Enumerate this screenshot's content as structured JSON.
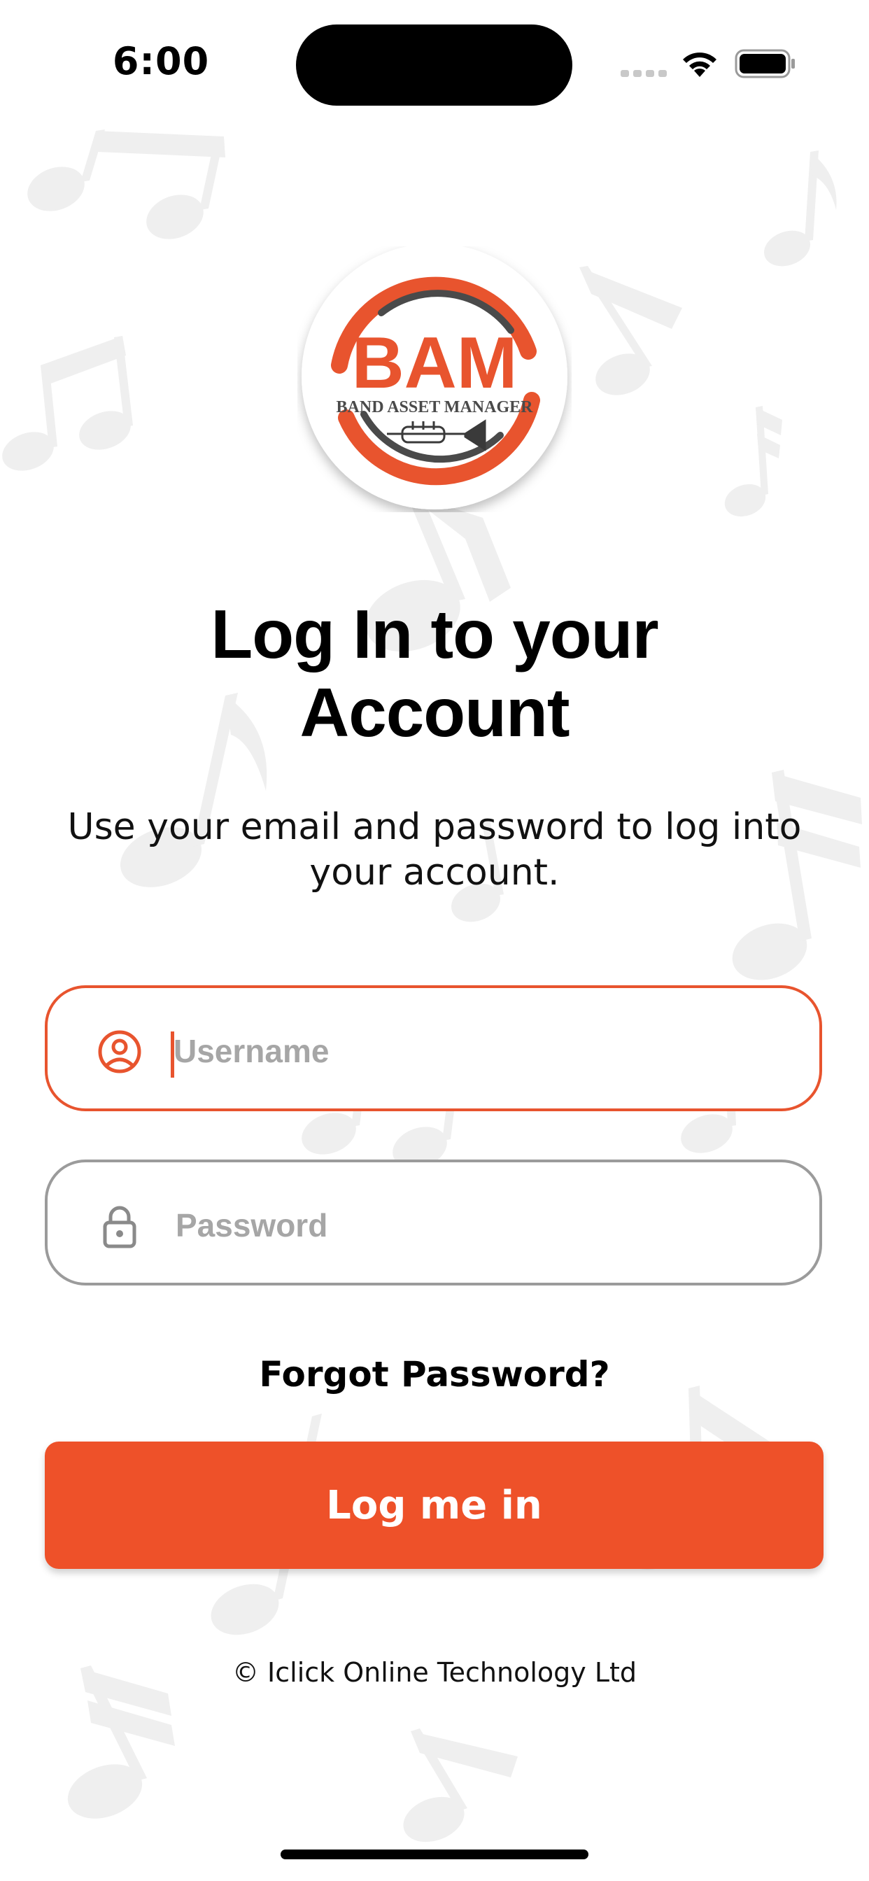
{
  "status_bar": {
    "time": "6:00",
    "icons": [
      "cellular-signal-icon",
      "wifi-icon",
      "battery-icon"
    ]
  },
  "logo": {
    "main": "BAM",
    "tagline": "BAND ASSET MANAGER",
    "icon": "trumpet-icon"
  },
  "heading": {
    "title_line1": "Log In to your",
    "title_line2": "Account",
    "subtitle_line1": "Use your email and password to log into",
    "subtitle_line2": "your account."
  },
  "form": {
    "username": {
      "placeholder": "Username",
      "value": "",
      "icon": "user-circle-icon"
    },
    "password": {
      "placeholder": "Password",
      "value": "",
      "icon": "lock-icon"
    },
    "forgot_label": "Forgot Password?",
    "submit_label": "Log me in"
  },
  "footer": {
    "copyright": "© Iclick Online Technology Ltd"
  },
  "colors": {
    "accent": "#EE5129",
    "logo_dark": "#4a4a4a",
    "muted": "#9b9b9b"
  }
}
